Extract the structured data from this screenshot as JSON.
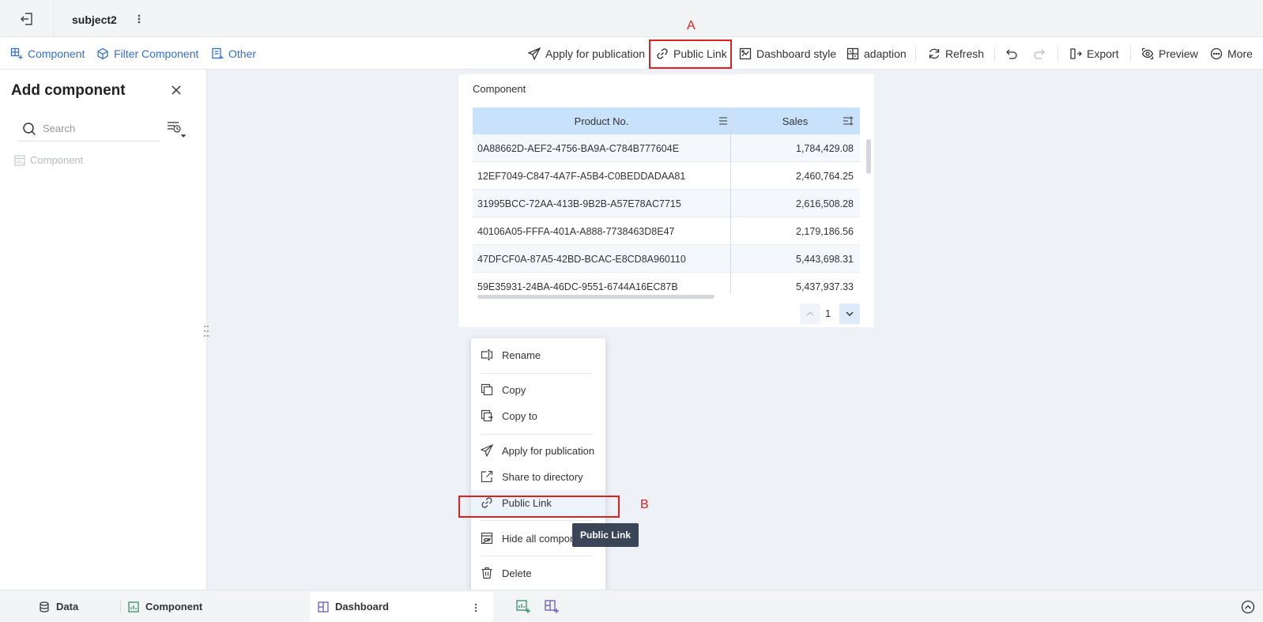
{
  "titlebar": {
    "title": "subject2"
  },
  "toolbar": {
    "component": "Component",
    "filter_component": "Filter Component",
    "other": "Other",
    "apply_publication": "Apply for publication",
    "public_link": "Public Link",
    "dashboard_style": "Dashboard style",
    "adaption": "adaption",
    "refresh": "Refresh",
    "export": "Export",
    "preview": "Preview",
    "more": "More"
  },
  "markers": {
    "a": "A",
    "b": "B"
  },
  "left_panel": {
    "title": "Add component",
    "search_placeholder": "Search",
    "tree_item": "Component"
  },
  "card": {
    "title": "Component",
    "columns": [
      "Product No.",
      "Sales"
    ],
    "rows": [
      {
        "product": "0A88662D-AEF2-4756-BA9A-C784B777604E",
        "sales": "1,784,429.08"
      },
      {
        "product": "12EF7049-C847-4A7F-A5B4-C0BEDDADAA81",
        "sales": "2,460,764.25"
      },
      {
        "product": "31995BCC-72AA-413B-9B2B-A57E78AC7715",
        "sales": "2,616,508.28"
      },
      {
        "product": "40106A05-FFFA-401A-A888-7738463D8E47",
        "sales": "2,179,186.56"
      },
      {
        "product": "47DFCF0A-87A5-42BD-BCAC-E8CD8A960110",
        "sales": "5,443,698.31"
      },
      {
        "product": "59E35931-24BA-46DC-9551-6744A16EC87B",
        "sales": "5,437,937.33"
      }
    ],
    "page": "1"
  },
  "context_menu": {
    "rename": "Rename",
    "copy": "Copy",
    "copy_to": "Copy to",
    "apply_publication": "Apply for publication",
    "share_directory": "Share to directory",
    "public_link": "Public Link",
    "hide_all": "Hide all components",
    "delete": "Delete"
  },
  "tooltip": "Public Link",
  "bottom": {
    "data": "Data",
    "component": "Component",
    "dashboard": "Dashboard"
  },
  "colors": {
    "accent": "#3370cc",
    "marker": "#e02020",
    "header_bg": "#c9e2fb"
  }
}
